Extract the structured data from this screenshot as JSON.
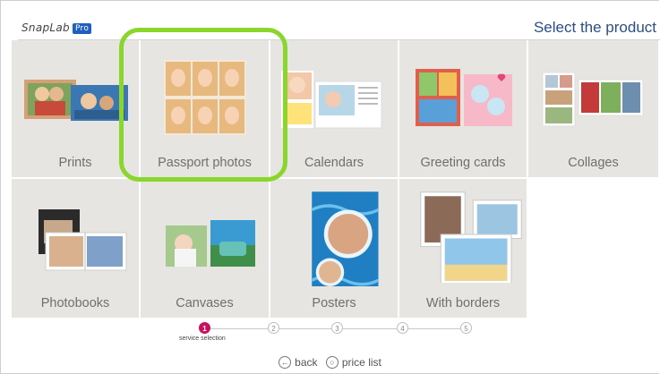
{
  "header": {
    "logo_text": "SnapLab",
    "logo_badge": "Pro",
    "title": "Select the product"
  },
  "products": [
    {
      "label": "Prints",
      "icon": "prints-thumbnail"
    },
    {
      "label": "Passport photos",
      "icon": "passport-photos-thumbnail"
    },
    {
      "label": "Calendars",
      "icon": "calendars-thumbnail"
    },
    {
      "label": "Greeting cards",
      "icon": "greeting-cards-thumbnail"
    },
    {
      "label": "Collages",
      "icon": "collages-thumbnail"
    },
    {
      "label": "Photobooks",
      "icon": "photobooks-thumbnail"
    },
    {
      "label": "Canvases",
      "icon": "canvases-thumbnail"
    },
    {
      "label": "Posters",
      "icon": "posters-thumbnail"
    },
    {
      "label": "With borders",
      "icon": "with-borders-thumbnail"
    }
  ],
  "stepper": {
    "steps": [
      "1",
      "2",
      "3",
      "4",
      "5"
    ],
    "active_index": 0,
    "active_caption": "service selection"
  },
  "footer": {
    "back_label": "back",
    "price_list_label": "price list"
  },
  "colors": {
    "highlight": "#8bd62d",
    "step_active": "#c7125b",
    "title": "#2a4e86",
    "tile_bg": "#e7e5e1"
  }
}
